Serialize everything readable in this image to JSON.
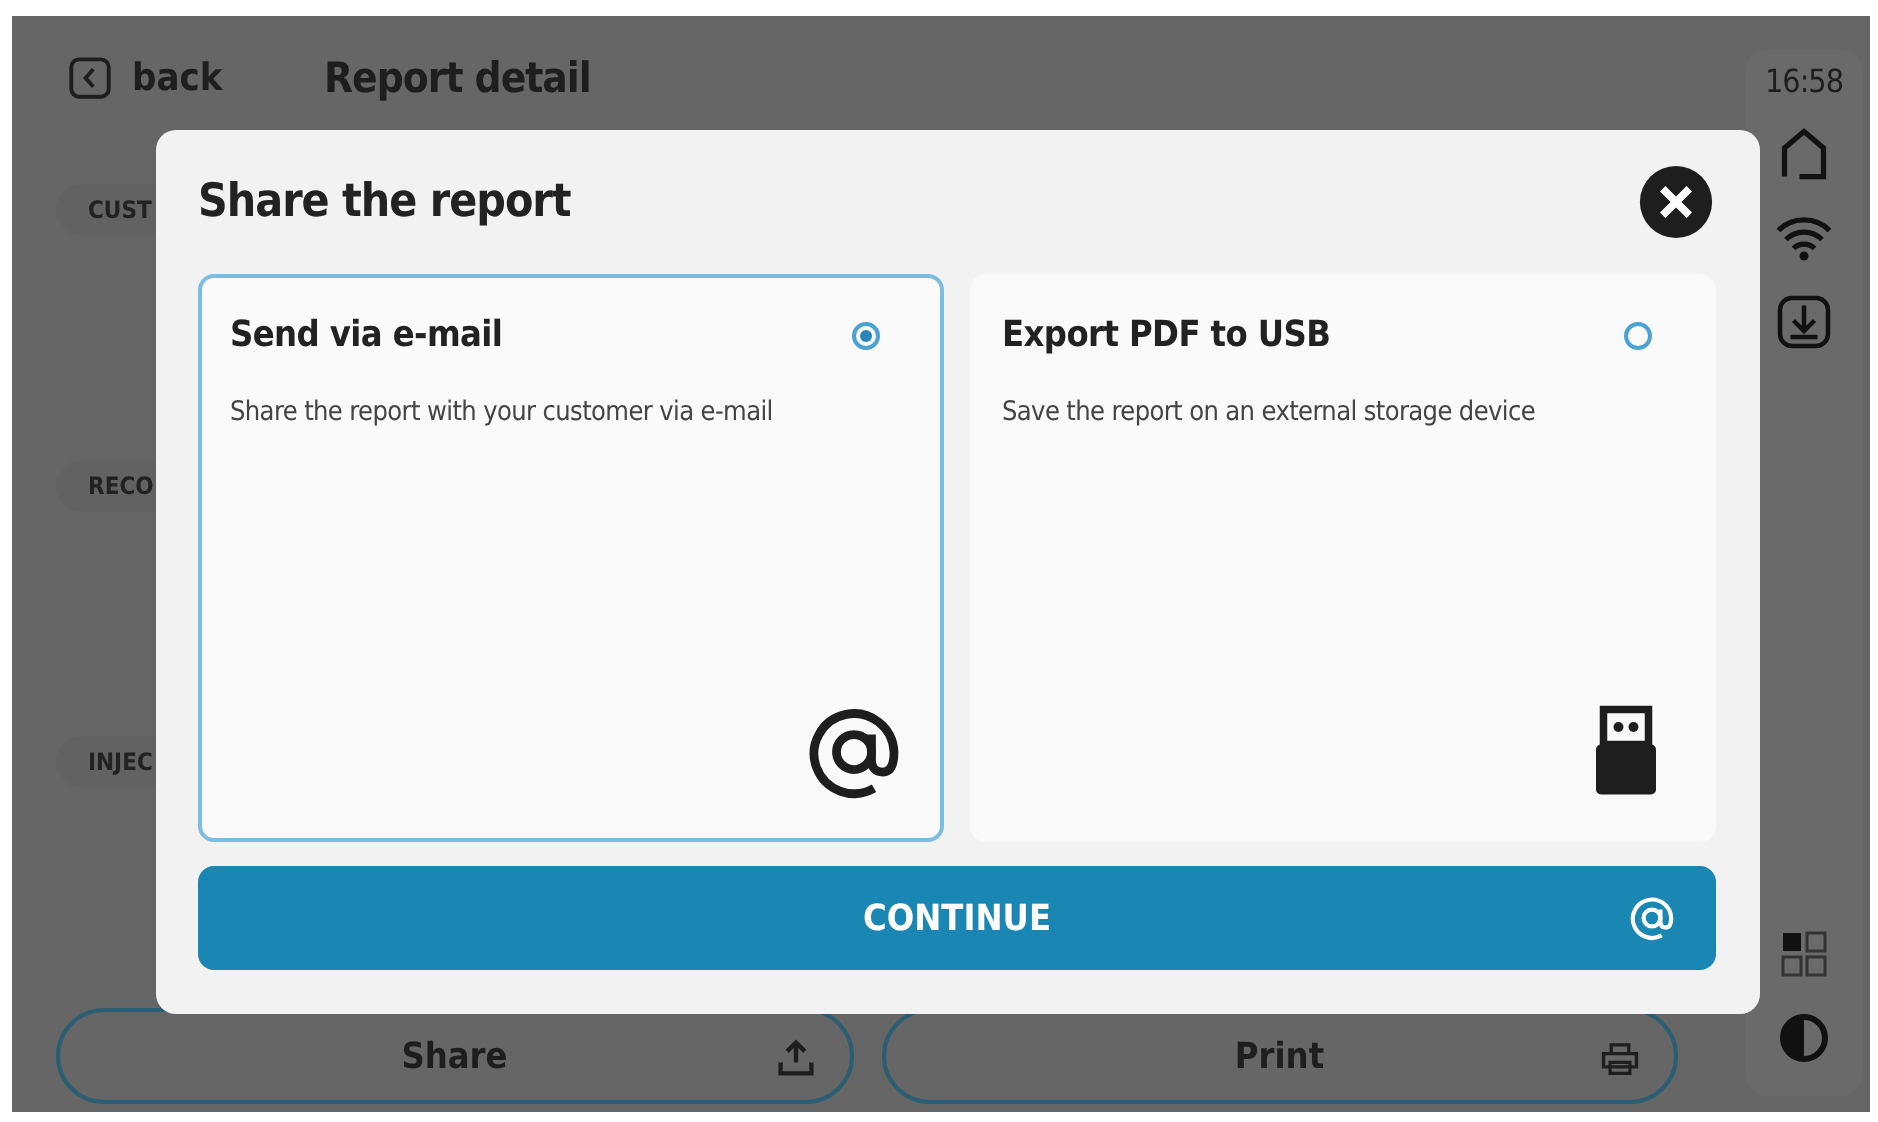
{
  "header": {
    "back_label": "back",
    "title": "Report detail"
  },
  "section_labels": [
    "CUST",
    "RECO",
    "INJEC"
  ],
  "actions": [
    {
      "label": "Share",
      "kind": "share"
    },
    {
      "label": "Print",
      "kind": "print"
    }
  ],
  "status": {
    "time": "16:58"
  },
  "dialog": {
    "title": "Share the report",
    "options": [
      {
        "kind": "email",
        "title": "Send via e-mail",
        "description": "Share the report with your customer via e-mail",
        "selected": true
      },
      {
        "kind": "usb",
        "title": "Export PDF to USB",
        "description": "Save the report on an external storage device",
        "selected": false
      }
    ],
    "continue_label": "CONTINUE"
  }
}
